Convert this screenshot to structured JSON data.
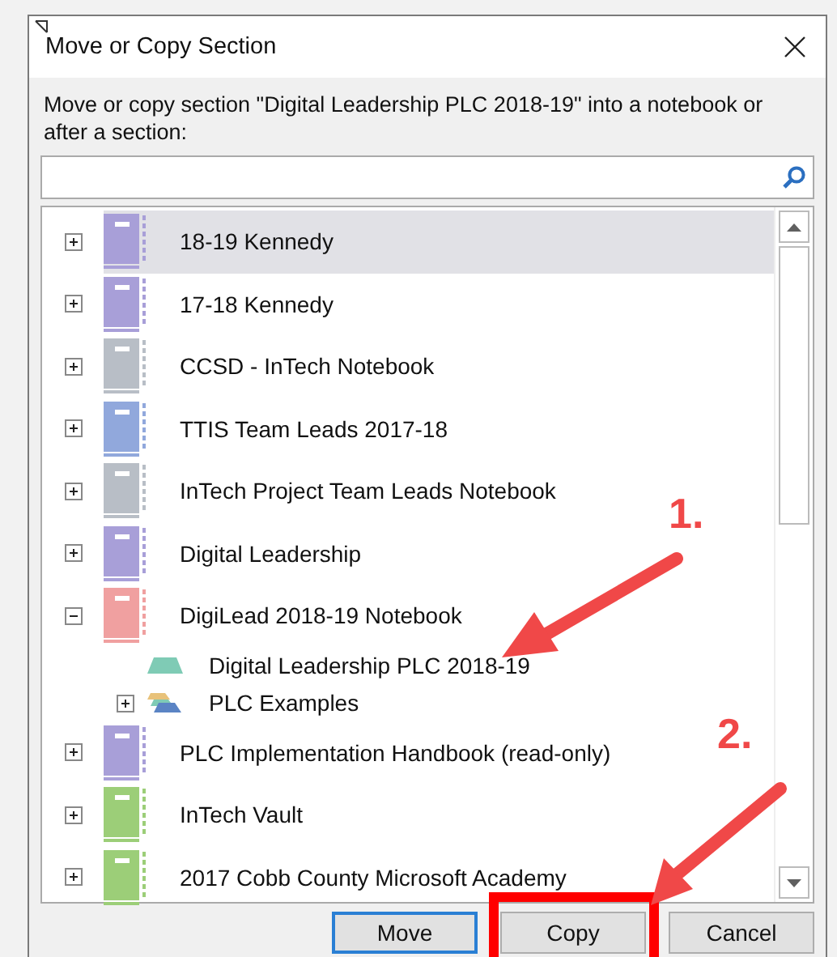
{
  "window": {
    "title": "Move or Copy Section"
  },
  "prompt": "Move or copy section \"Digital Leadership PLC 2018-19\" into a notebook or after a section:",
  "tree": [
    {
      "label": "18-19 Kennedy",
      "kind": "notebook",
      "color": "#a89fd8",
      "selected": true,
      "expanded": false
    },
    {
      "label": "17-18 Kennedy",
      "kind": "notebook",
      "color": "#a89fd8",
      "selected": false,
      "expanded": false
    },
    {
      "label": "CCSD - InTech Notebook",
      "kind": "notebook",
      "color": "#b8bec6",
      "selected": false,
      "expanded": false
    },
    {
      "label": "TTIS Team Leads 2017-18",
      "kind": "notebook",
      "color": "#91a8dc",
      "selected": false,
      "expanded": false
    },
    {
      "label": "InTech Project Team Leads Notebook",
      "kind": "notebook",
      "color": "#b8bec6",
      "selected": false,
      "expanded": false
    },
    {
      "label": "Digital Leadership",
      "kind": "notebook",
      "color": "#a89fd8",
      "selected": false,
      "expanded": false
    },
    {
      "label": "DigiLead 2018-19 Notebook",
      "kind": "notebook",
      "color": "#f0a0a0",
      "selected": false,
      "expanded": true,
      "children": [
        {
          "label": "Digital Leadership PLC 2018-19",
          "kind": "section",
          "color": "#7fcbb5",
          "selected": false
        },
        {
          "label": "PLC Examples",
          "kind": "section-group",
          "color": "#5b84c4",
          "selected": false,
          "expanded": false
        }
      ]
    },
    {
      "label": "PLC Implementation Handbook (read-only)",
      "kind": "notebook",
      "color": "#a89fd8",
      "selected": false,
      "expanded": false
    },
    {
      "label": "InTech Vault",
      "kind": "notebook",
      "color": "#9cce78",
      "selected": false,
      "expanded": false
    },
    {
      "label": "2017 Cobb County Microsoft Academy",
      "kind": "notebook",
      "color": "#9cce78",
      "selected": false,
      "expanded": false
    }
  ],
  "buttons": [
    {
      "label": "Move",
      "default": true
    },
    {
      "label": "Copy",
      "default": false
    },
    {
      "label": "Cancel",
      "default": false
    }
  ],
  "annotations": [
    {
      "label": "1."
    },
    {
      "label": "2."
    }
  ]
}
